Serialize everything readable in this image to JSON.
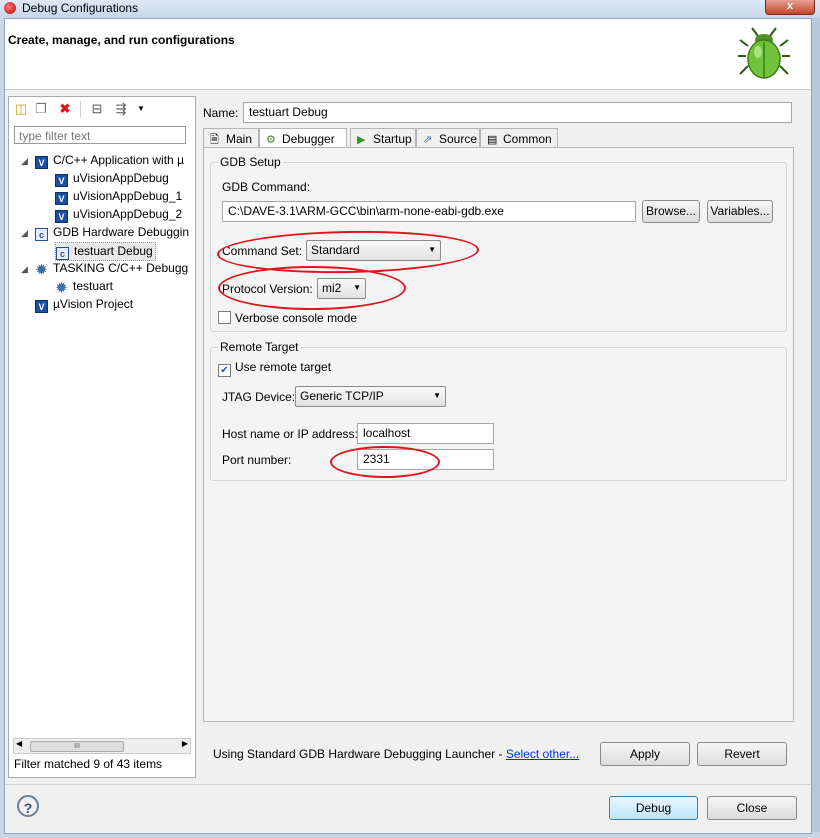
{
  "window": {
    "title": "Debug Configurations",
    "close_glyph": "x"
  },
  "header": {
    "text": "Create, manage, and run configurations"
  },
  "toolbar": {
    "icons": [
      "new-config-icon",
      "duplicate-icon",
      "delete-icon",
      "collapse-all-icon",
      "filter-icon",
      "dropdown-icon"
    ]
  },
  "filter": {
    "placeholder": "type filter text"
  },
  "tree": {
    "items": [
      {
        "label": "C/C++ Application with µ"
      },
      {
        "label": "uVisionAppDebug"
      },
      {
        "label": "uVisionAppDebug_1"
      },
      {
        "label": "uVisionAppDebug_2"
      },
      {
        "label": "GDB Hardware Debuggin"
      },
      {
        "label": "testuart Debug"
      },
      {
        "label": "TASKING C/C++ Debugg"
      },
      {
        "label": "testuart"
      },
      {
        "label": "µVision Project"
      }
    ],
    "scroll_thumb": "III"
  },
  "filter_status": "Filter matched 9 of 43 items",
  "config": {
    "name_label": "Name:",
    "name_value": "testuart Debug",
    "tabs": [
      {
        "label": "Main",
        "icon": "main-tab-icon"
      },
      {
        "label": "Debugger",
        "icon": "bug-gear-icon"
      },
      {
        "label": "Startup",
        "icon": "run-arrow-icon"
      },
      {
        "label": "Source",
        "icon": "source-icon"
      },
      {
        "label": "Common",
        "icon": "common-icon"
      }
    ],
    "active_tab": "Debugger"
  },
  "gdb_setup": {
    "title": "GDB Setup",
    "command_label": "GDB Command:",
    "command_value": "C:\\DAVE-3.1\\ARM-GCC\\bin\\arm-none-eabi-gdb.exe",
    "browse_label": "Browse...",
    "variables_label": "Variables...",
    "command_set_label": "Command Set:",
    "command_set_value": "Standard",
    "protocol_label": "Protocol Version:",
    "protocol_value": "mi2",
    "verbose_label": "Verbose console mode",
    "verbose_checked": false
  },
  "remote_target": {
    "title": "Remote Target",
    "use_remote_label": "Use remote target",
    "use_remote_checked": true,
    "jtag_label": "JTAG Device:",
    "jtag_value": "Generic TCP/IP",
    "host_label": "Host name or IP address:",
    "host_value": "localhost",
    "port_label": "Port number:",
    "port_value": "2331"
  },
  "launcher": {
    "text": "Using Standard GDB Hardware Debugging Launcher - ",
    "link": "Select other..."
  },
  "buttons": {
    "apply": "Apply",
    "revert": "Revert",
    "debug": "Debug",
    "close": "Close",
    "help": "?"
  },
  "colors": {
    "annotation": "#e0141d",
    "link": "#0033cc"
  }
}
